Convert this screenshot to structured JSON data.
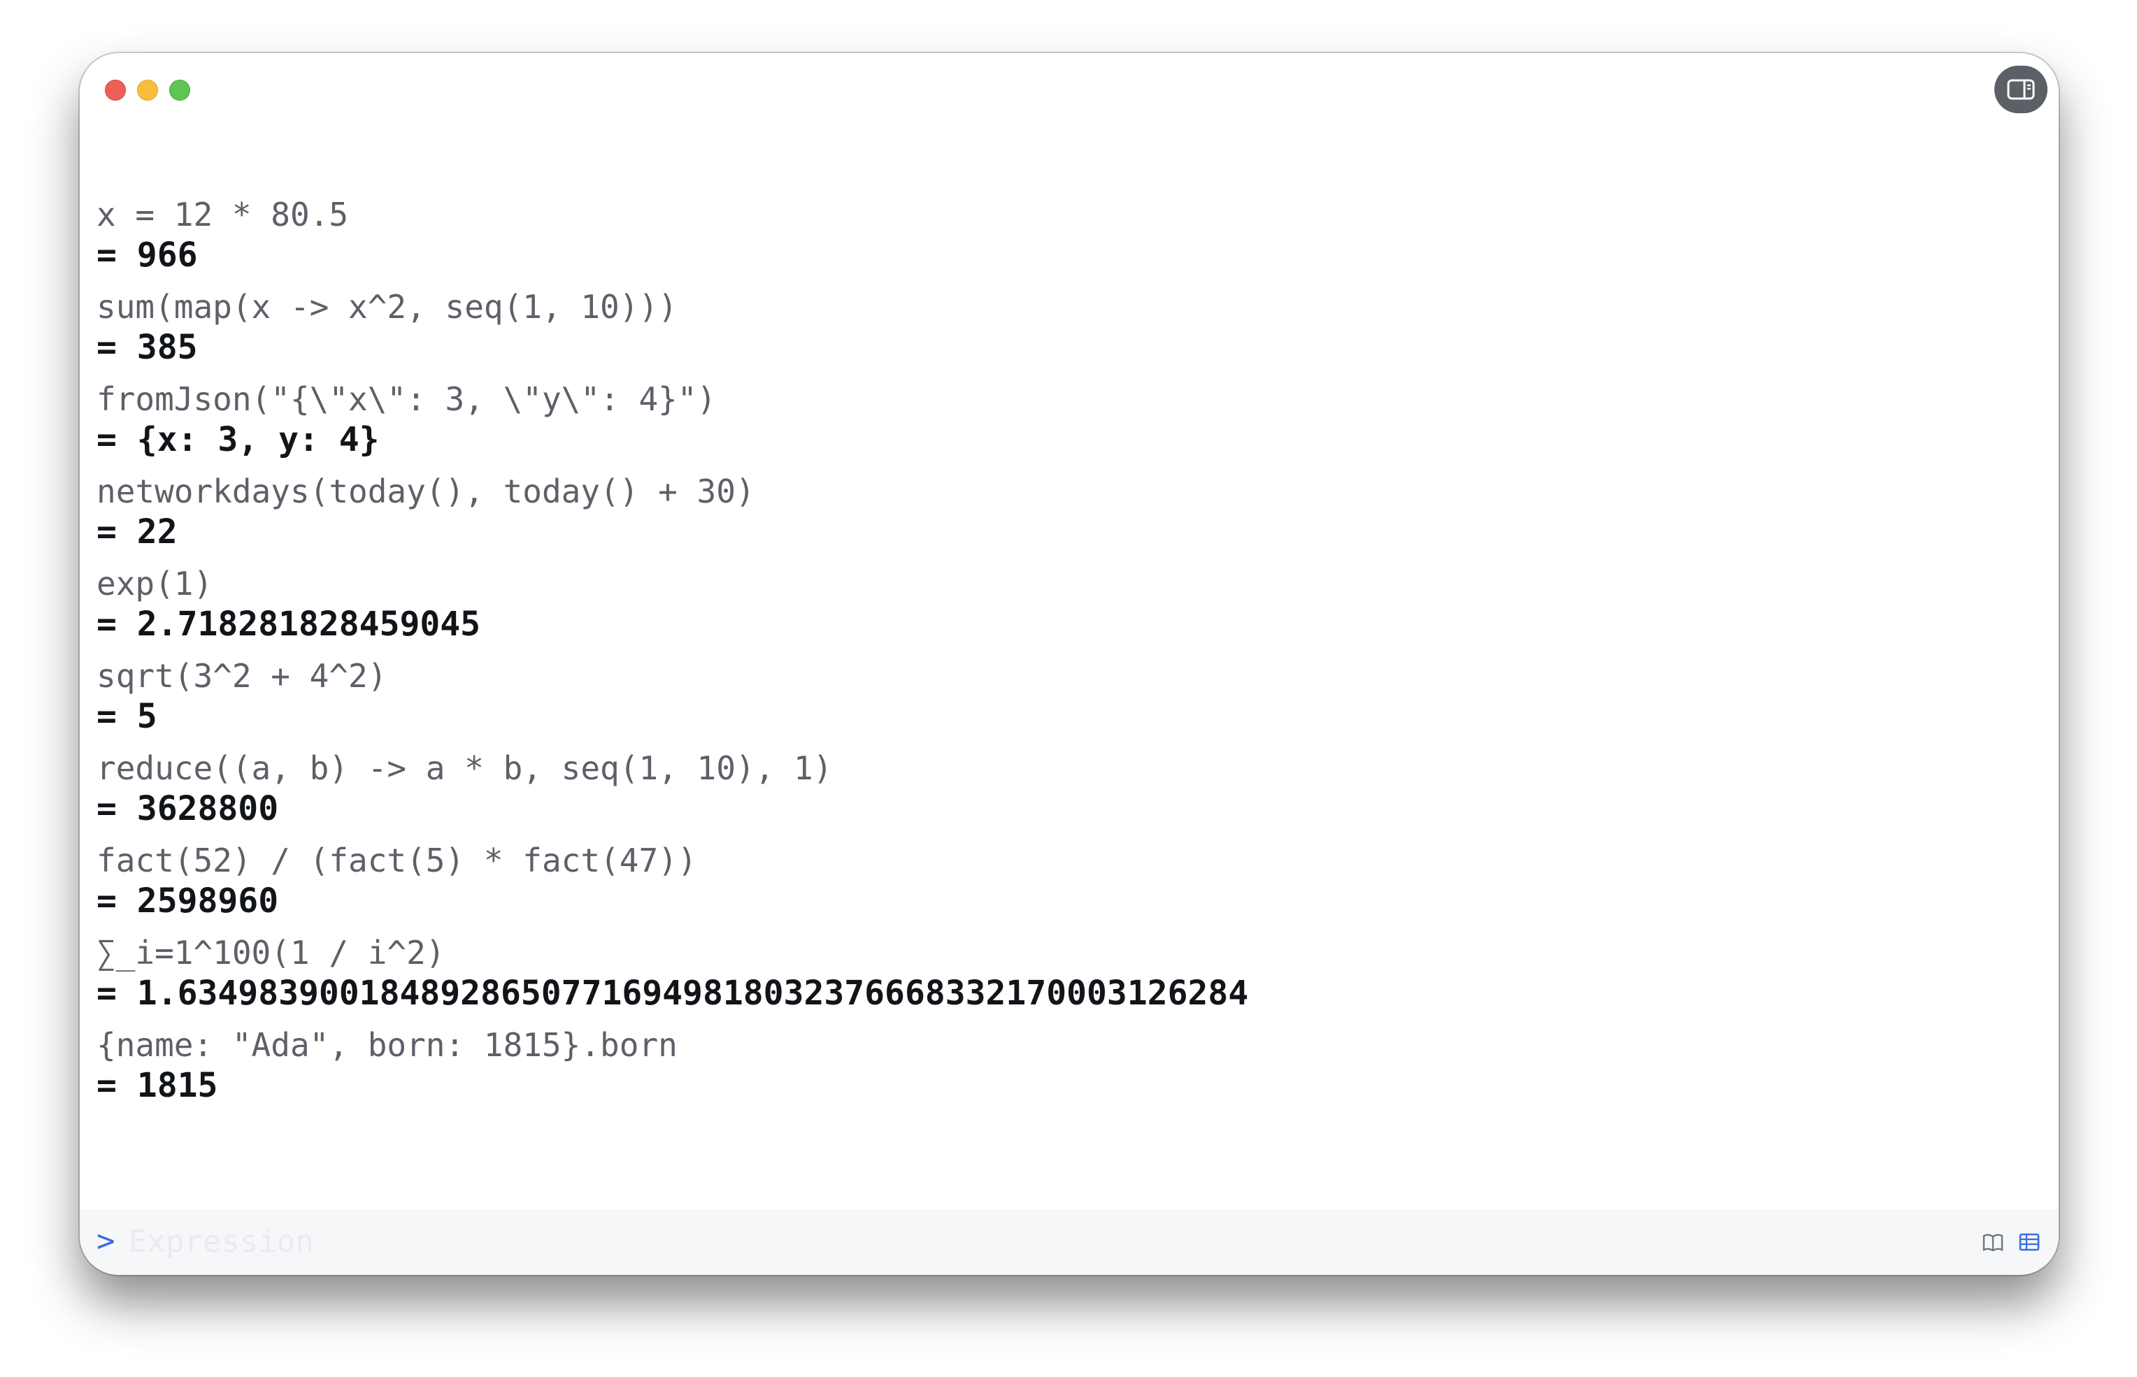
{
  "window": {
    "controls": {
      "close": "close-button",
      "minimize": "minimize-button",
      "zoom": "zoom-button",
      "sidebar_toggle_icon": "sidebar-icon"
    }
  },
  "history": [
    {
      "expression": "x = 12 * 80.5",
      "result": "= 966"
    },
    {
      "expression": "sum(map(x -> x^2, seq(1, 10)))",
      "result": "= 385"
    },
    {
      "expression": "fromJson(\"{\\\"x\\\": 3, \\\"y\\\": 4}\")",
      "result": "= {x: 3, y: 4}"
    },
    {
      "expression": "networkdays(today(), today() + 30)",
      "result": "= 22"
    },
    {
      "expression": "exp(1)",
      "result": "= 2.718281828459045"
    },
    {
      "expression": "sqrt(3^2 + 4^2)",
      "result": "= 5"
    },
    {
      "expression": "reduce((a, b) -> a * b, seq(1, 10), 1)",
      "result": "= 3628800"
    },
    {
      "expression": "fact(52) / (fact(5) * fact(47))",
      "result": "= 2598960"
    },
    {
      "expression": "∑_i=1^100(1 / i^2)",
      "result": "= 1.6349839001848928650771694981803237666833217000312628​4"
    },
    {
      "expression": "{name: \"Ada\", born: 1815}.born",
      "result": "= 1815"
    }
  ],
  "input": {
    "prompt": ">",
    "value": "",
    "placeholder": "Expression"
  },
  "icons": {
    "docs": "book-icon",
    "table": "table-icon"
  },
  "colors": {
    "prompt": "#3a6fd8",
    "close": "#ee5f58",
    "minimize": "#f7be3b",
    "zoom": "#5fc454"
  }
}
